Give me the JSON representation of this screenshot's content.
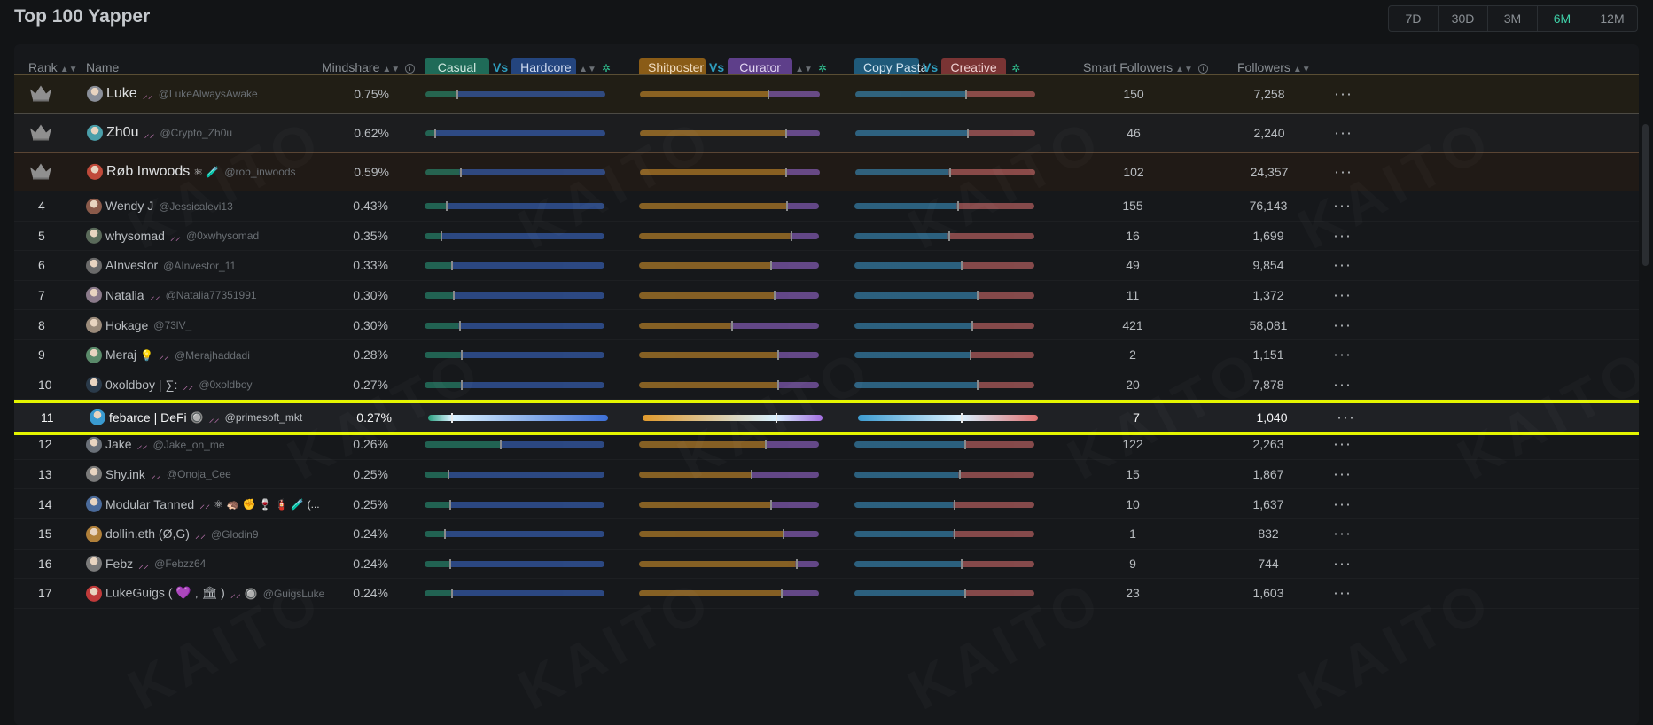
{
  "title": "Top 100 Yapper",
  "ranges": {
    "options": [
      "7D",
      "30D",
      "3M",
      "6M",
      "12M"
    ],
    "selected": "6M",
    "active_color": "#3fd0a8"
  },
  "watermark_text": "KAITO",
  "columns": {
    "rank": "Rank",
    "name": "Name",
    "mindshare": "Mindshare",
    "casual": "Casual",
    "vs": "Vs",
    "hardcore": "Hardcore",
    "shitposter": "Shitposter",
    "curator": "Curator",
    "copy_pasta": "Copy Pasta",
    "creative": "Creative",
    "smart_followers": "Smart Followers",
    "followers": "Followers"
  },
  "colors": {
    "casual": "#2a9f7f",
    "hardcore": "#3d6fd6",
    "shitposter": "#e09a2c",
    "curator": "#a36fe0",
    "copy_pasta": "#3d9bd0",
    "creative": "#e07272",
    "highlight_border": "#e4f500"
  },
  "rows": [
    {
      "rank": "1",
      "crown": true,
      "name": "Luke",
      "bird": true,
      "emojis": "",
      "handle": "@LukeAlwaysAwake",
      "mindshare": "0.75%",
      "cvh": 0.17,
      "svc": 0.71,
      "cvc": 0.61,
      "smart": "150",
      "followers": "7,258",
      "avatar": "#8a8f99"
    },
    {
      "rank": "2",
      "crown": true,
      "name": "Zh0u",
      "bird": true,
      "emojis": "",
      "handle": "@Crypto_Zh0u",
      "mindshare": "0.62%",
      "cvh": 0.05,
      "svc": 0.81,
      "cvc": 0.62,
      "smart": "46",
      "followers": "2,240",
      "avatar": "#4a9faa"
    },
    {
      "rank": "3",
      "crown": true,
      "name": "Røb Inwoods",
      "bird": false,
      "emojis": "⚛ 🧪",
      "handle": "@rob_inwoods",
      "mindshare": "0.59%",
      "cvh": 0.19,
      "svc": 0.81,
      "cvc": 0.52,
      "smart": "102",
      "followers": "24,357",
      "avatar": "#c04a3a"
    },
    {
      "rank": "4",
      "crown": false,
      "name": "Wendy J",
      "bird": false,
      "emojis": "",
      "handle": "@Jessicalevi13",
      "mindshare": "0.43%",
      "cvh": 0.12,
      "svc": 0.82,
      "cvc": 0.57,
      "smart": "155",
      "followers": "76,143",
      "avatar": "#8a5a4a"
    },
    {
      "rank": "5",
      "crown": false,
      "name": "whysomad",
      "bird": true,
      "emojis": "",
      "handle": "@0xwhysomad",
      "mindshare": "0.35%",
      "cvh": 0.09,
      "svc": 0.84,
      "cvc": 0.52,
      "smart": "16",
      "followers": "1,699",
      "avatar": "#5a6a5a"
    },
    {
      "rank": "6",
      "crown": false,
      "name": "AInvestor",
      "bird": false,
      "emojis": "",
      "handle": "@AInvestor_11",
      "mindshare": "0.33%",
      "cvh": 0.15,
      "svc": 0.73,
      "cvc": 0.59,
      "smart": "49",
      "followers": "9,854",
      "avatar": "#6a6a6a"
    },
    {
      "rank": "7",
      "crown": false,
      "name": "Natalia",
      "bird": true,
      "emojis": "",
      "handle": "@Natalia77351991",
      "mindshare": "0.30%",
      "cvh": 0.16,
      "svc": 0.75,
      "cvc": 0.68,
      "smart": "11",
      "followers": "1,372",
      "avatar": "#8a7a8a"
    },
    {
      "rank": "8",
      "crown": false,
      "name": "Hokage",
      "bird": false,
      "emojis": "",
      "handle": "@73lV_",
      "mindshare": "0.30%",
      "cvh": 0.19,
      "svc": 0.51,
      "cvc": 0.65,
      "smart": "421",
      "followers": "58,081",
      "avatar": "#9a8a7a"
    },
    {
      "rank": "9",
      "crown": false,
      "name": "Meraj",
      "bird": true,
      "emojis": "💡",
      "handle": "@Merajhaddadi",
      "mindshare": "0.28%",
      "cvh": 0.2,
      "svc": 0.77,
      "cvc": 0.64,
      "smart": "2",
      "followers": "1,151",
      "avatar": "#5a8a6a"
    },
    {
      "rank": "10",
      "crown": false,
      "name": "0xoldboy | ∑:",
      "bird": true,
      "emojis": "",
      "handle": "@0xoldboy",
      "mindshare": "0.27%",
      "cvh": 0.2,
      "svc": 0.77,
      "cvc": 0.68,
      "smart": "20",
      "followers": "7,878",
      "avatar": "#2a3a4a"
    },
    {
      "rank": "11",
      "crown": false,
      "highlight": true,
      "name": "febarce | DeFi",
      "bird": true,
      "emojis": "🔘",
      "handle": "@primesoft_mkt",
      "mindshare": "0.27%",
      "cvh": 0.13,
      "svc": 0.74,
      "cvc": 0.57,
      "smart": "7",
      "followers": "1,040",
      "avatar": "#3a9ad0"
    },
    {
      "rank": "12",
      "crown": false,
      "name": "Jake",
      "bird": true,
      "emojis": "",
      "handle": "@Jake_on_me",
      "mindshare": "0.26%",
      "cvh": 0.42,
      "svc": 0.7,
      "cvc": 0.61,
      "smart": "122",
      "followers": "2,263",
      "avatar": "#6a7078"
    },
    {
      "rank": "13",
      "crown": false,
      "name": "Shy.ink",
      "bird": true,
      "emojis": "",
      "handle": "@Onoja_Cee",
      "mindshare": "0.25%",
      "cvh": 0.13,
      "svc": 0.62,
      "cvc": 0.58,
      "smart": "15",
      "followers": "1,867",
      "avatar": "#7a7a7a"
    },
    {
      "rank": "14",
      "crown": false,
      "name": "Modular Tanned",
      "bird": true,
      "emojis": "⚛ 🦔 ✊ 🍷 🧯 🧪 (...",
      "handle": "",
      "mindshare": "0.25%",
      "cvh": 0.14,
      "svc": 0.73,
      "cvc": 0.55,
      "smart": "10",
      "followers": "1,637",
      "avatar": "#4a6a9a"
    },
    {
      "rank": "15",
      "crown": false,
      "name": "dollin.eth (Ø,G)",
      "bird": true,
      "emojis": "",
      "handle": "@Glodin9",
      "mindshare": "0.24%",
      "cvh": 0.11,
      "svc": 0.8,
      "cvc": 0.55,
      "smart": "1",
      "followers": "832",
      "avatar": "#b0803a"
    },
    {
      "rank": "16",
      "crown": false,
      "name": "Febz",
      "bird": true,
      "emojis": "",
      "handle": "@Febzz64",
      "mindshare": "0.24%",
      "cvh": 0.14,
      "svc": 0.87,
      "cvc": 0.59,
      "smart": "9",
      "followers": "744",
      "avatar": "#7a7a7a"
    },
    {
      "rank": "17",
      "crown": false,
      "name": "LukeGuigs ( 💜 , 🏛 )",
      "bird": true,
      "emojis": "🔘",
      "handle": "@GuigsLuke",
      "mindshare": "0.24%",
      "cvh": 0.15,
      "svc": 0.79,
      "cvc": 0.61,
      "smart": "23",
      "followers": "1,603",
      "avatar": "#c03a3a"
    }
  ]
}
